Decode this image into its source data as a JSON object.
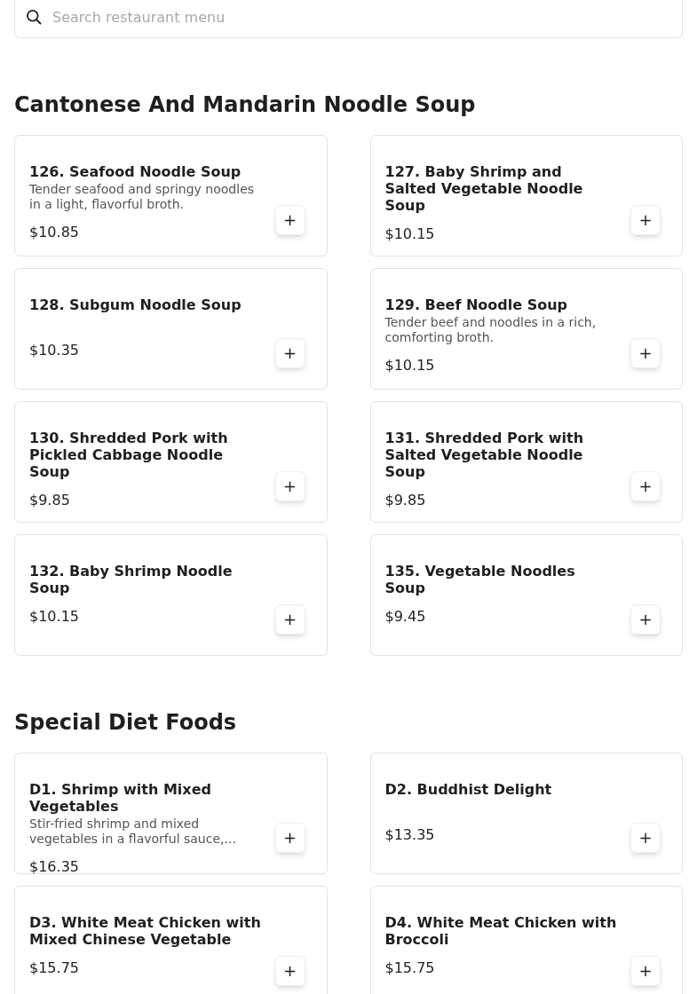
{
  "search": {
    "placeholder": "Search restaurant menu"
  },
  "sections": [
    {
      "title": "Cantonese And Mandarin Noodle Soup",
      "items": [
        {
          "name": "126. Seafood Noodle Soup",
          "description": "Tender seafood and springy noodles in a light, flavorful broth.",
          "price": "$10.85",
          "button": "+"
        },
        {
          "name": "127. Baby Shrimp and Salted Vegetable Noodle Soup",
          "price": "$10.15",
          "button": "+"
        },
        {
          "name": "128. Subgum Noodle Soup",
          "price": "$10.35",
          "button": "+"
        },
        {
          "name": "129. Beef Noodle Soup",
          "description": "Tender beef and noodles in a rich, comforting broth.",
          "price": "$10.15",
          "button": "+"
        },
        {
          "name": "130. Shredded Pork with Pickled Cabbage Noodle Soup",
          "price": "$9.85",
          "button": "+"
        },
        {
          "name": "131. Shredded Pork with Salted Vegetable Noodle Soup",
          "price": "$9.85",
          "button": "+"
        },
        {
          "name": "132. Baby Shrimp Noodle Soup",
          "price": "$10.15",
          "button": "+"
        },
        {
          "name": "135. Vegetable Noodles Soup",
          "price": "$9.45",
          "button": "+"
        }
      ]
    },
    {
      "title": "Special Diet Foods",
      "items": [
        {
          "name": "D1. Shrimp with Mixed Vegetables",
          "description": "Stir-fried shrimp and mixed vegetables in a flavorful sauce,...",
          "price": "$16.35",
          "button": "+"
        },
        {
          "name": "D2. Buddhist Delight",
          "price": "$13.35",
          "button": "+"
        },
        {
          "name": "D3. White Meat Chicken with Mixed Chinese Vegetable",
          "price": "$15.75",
          "button": "+"
        },
        {
          "name": "D4. White Meat Chicken with Broccoli",
          "price": "$15.75",
          "button": "+"
        }
      ]
    }
  ]
}
